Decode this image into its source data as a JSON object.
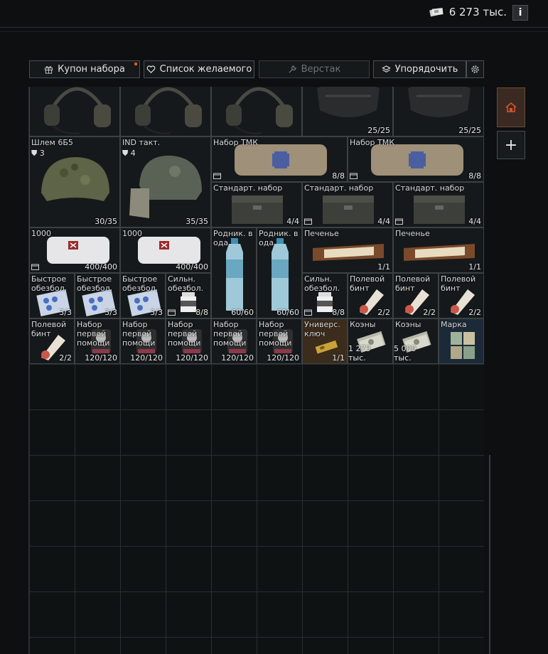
{
  "header": {
    "currency_value": "6 273 тыс.",
    "info_label": "i"
  },
  "toolbar": {
    "coupon_label": "Купон набора",
    "wishlist_label": "Список желаемого",
    "workbench_label": "Верстак",
    "sort_label": "Упорядочить"
  },
  "side": {
    "add_label": "+"
  },
  "items": {
    "r0c0": {
      "count": ""
    },
    "r0c1": {
      "count": ""
    },
    "r0c2": {
      "count": ""
    },
    "r0c3": {
      "count": "25/25"
    },
    "r0c4": {
      "count": "25/25"
    },
    "helmet1": {
      "name": "Шлем 6Б5",
      "armor": "3",
      "count": "30/35"
    },
    "helmet2": {
      "name": "IND такт.",
      "armor": "4",
      "count": "35/35"
    },
    "tmk1": {
      "name": "Набор ТМК",
      "count": "8/8"
    },
    "tmk2": {
      "name": "Набор ТМК",
      "count": "8/8"
    },
    "std1": {
      "name": "Стандарт. набор",
      "count": "4/4"
    },
    "std2": {
      "name": "Стандарт. набор",
      "count": "4/4"
    },
    "std3": {
      "name": "Стандарт. набор",
      "count": "4/4"
    },
    "k1000a": {
      "name": "1000",
      "count": "400/400"
    },
    "k1000b": {
      "name": "1000",
      "count": "400/400"
    },
    "water1": {
      "name": "Родник. в\nода",
      "count": "60/60"
    },
    "water2": {
      "name": "Родник. в\nода",
      "count": "60/60"
    },
    "cookie1": {
      "name": "Печенье",
      "count": "1/1"
    },
    "cookie2": {
      "name": "Печенье",
      "count": "1/1"
    },
    "pain1": {
      "name": "Быстрое\nобезбол.",
      "count": "3/3"
    },
    "pain2": {
      "name": "Быстрое\nобезбол.",
      "count": "3/3"
    },
    "pain3": {
      "name": "Быстрое\nобезбол.",
      "count": "3/3"
    },
    "strong1": {
      "name": "Сильн.\nобезбол.",
      "count": "8/8"
    },
    "strong2": {
      "name": "Сильн.\nобезбол.",
      "count": "8/8"
    },
    "band1": {
      "name": "Полевой\nбинт",
      "count": "2/2"
    },
    "band2": {
      "name": "Полевой\nбинт",
      "count": "2/2"
    },
    "band3": {
      "name": "Полевой\nбинт",
      "count": "2/2"
    },
    "band4": {
      "name": "Полевой\nбинт",
      "count": "2/2"
    },
    "fa1": {
      "name": "Набор\nпервой\nпомощи",
      "count": "120/120"
    },
    "fa2": {
      "name": "Набор\nпервой\nпомощи",
      "count": "120/120"
    },
    "fa3": {
      "name": "Набор\nпервой\nпомощи",
      "count": "120/120"
    },
    "fa4": {
      "name": "Набор\nпервой\nпомощи",
      "count": "120/120"
    },
    "fa5": {
      "name": "Набор\nпервой\nпомощи",
      "count": "120/120"
    },
    "key": {
      "name": "Универс.\nключ",
      "count": "1/1"
    },
    "coins1": {
      "name": "Коэны",
      "count": "1 273 тыс."
    },
    "coins2": {
      "name": "Коэны",
      "count": "5 000 тыс."
    },
    "stamp": {
      "name": "Марка",
      "count": ""
    }
  },
  "colors": {
    "accent_home": "#d9542b",
    "grid_line": "#2a2e30",
    "background": "#0d0f10"
  }
}
